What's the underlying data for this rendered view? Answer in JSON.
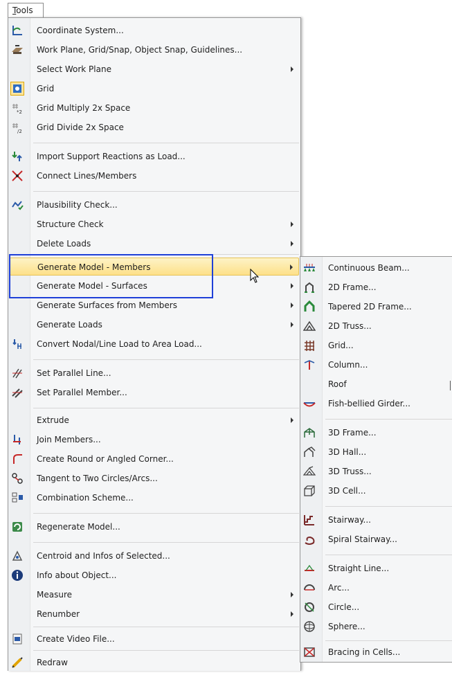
{
  "menubar": {
    "tools_mnemonic": "T",
    "tools_rest": "ools"
  },
  "colors": {
    "highlight": "#fde089",
    "focus_box": "#1f40d8"
  },
  "main_menu": {
    "items": [
      {
        "label": "Coordinate System...",
        "icon": "coordinate-system-icon",
        "has_submenu": false
      },
      {
        "label": "Work Plane, Grid/Snap, Object Snap, Guidelines...",
        "icon": "work-plane-icon",
        "has_submenu": false
      },
      {
        "label": "Select Work Plane",
        "icon": "",
        "has_submenu": true
      },
      {
        "label": "Grid",
        "icon": "grid-icon",
        "has_submenu": false,
        "checked": true
      },
      {
        "label": "Grid Multiply 2x Space",
        "icon": "grid-multiply-icon",
        "has_submenu": false
      },
      {
        "label": "Grid Divide 2x Space",
        "icon": "grid-divide-icon",
        "has_submenu": false
      },
      {
        "label": "Import Support Reactions as Load...",
        "icon": "import-reactions-icon",
        "has_submenu": false
      },
      {
        "label": "Connect Lines/Members",
        "icon": "connect-lines-icon",
        "has_submenu": false
      },
      {
        "label": "Plausibility Check...",
        "icon": "plausibility-check-icon",
        "has_submenu": false
      },
      {
        "label": "Structure Check",
        "icon": "",
        "has_submenu": true
      },
      {
        "label": "Delete Loads",
        "icon": "",
        "has_submenu": true
      },
      {
        "label": "Generate Model - Members",
        "icon": "",
        "has_submenu": true,
        "highlighted": true
      },
      {
        "label": "Generate Model - Surfaces",
        "icon": "",
        "has_submenu": true
      },
      {
        "label": "Generate Surfaces from Members",
        "icon": "",
        "has_submenu": true
      },
      {
        "label": "Generate Loads",
        "icon": "",
        "has_submenu": true
      },
      {
        "label": "Convert Nodal/Line Load to Area Load...",
        "icon": "convert-load-icon",
        "has_submenu": false
      },
      {
        "label": "Set Parallel Line...",
        "icon": "parallel-line-icon",
        "has_submenu": false
      },
      {
        "label": "Set Parallel Member...",
        "icon": "parallel-member-icon",
        "has_submenu": false
      },
      {
        "label": "Extrude",
        "icon": "",
        "has_submenu": true
      },
      {
        "label": "Join Members...",
        "icon": "join-members-icon",
        "has_submenu": false
      },
      {
        "label": "Create Round or Angled Corner...",
        "icon": "corner-icon",
        "has_submenu": false
      },
      {
        "label": "Tangent to Two Circles/Arcs...",
        "icon": "tangent-icon",
        "has_submenu": false
      },
      {
        "label": "Combination Scheme...",
        "icon": "combination-scheme-icon",
        "has_submenu": false
      },
      {
        "label": "Regenerate Model...",
        "icon": "regenerate-icon",
        "has_submenu": false
      },
      {
        "label": "Centroid and Infos of Selected...",
        "icon": "centroid-icon",
        "has_submenu": false
      },
      {
        "label": "Info about Object...",
        "icon": "info-icon",
        "has_submenu": false
      },
      {
        "label": "Measure",
        "icon": "",
        "has_submenu": true
      },
      {
        "label": "Renumber",
        "icon": "",
        "has_submenu": true
      },
      {
        "label": "Create Video File...",
        "icon": "video-file-icon",
        "has_submenu": false
      },
      {
        "label": "Redraw",
        "icon": "redraw-icon",
        "has_submenu": false
      }
    ]
  },
  "sub_menu": {
    "items": [
      {
        "label": "Continuous Beam...",
        "icon": "continuous-beam-icon"
      },
      {
        "label": "2D Frame...",
        "icon": "frame-2d-icon"
      },
      {
        "label": "Tapered 2D Frame...",
        "icon": "tapered-frame-icon"
      },
      {
        "label": "2D Truss...",
        "icon": "truss-2d-icon"
      },
      {
        "label": "Grid...",
        "icon": "grid-model-icon"
      },
      {
        "label": "Column...",
        "icon": "column-icon"
      },
      {
        "label": "Roof",
        "icon": ""
      },
      {
        "label": "Fish-bellied Girder...",
        "icon": "fish-girder-icon"
      },
      {
        "label": "3D Frame...",
        "icon": "frame-3d-icon"
      },
      {
        "label": "3D Hall...",
        "icon": "hall-3d-icon"
      },
      {
        "label": "3D Truss...",
        "icon": "truss-3d-icon"
      },
      {
        "label": "3D Cell...",
        "icon": "cell-3d-icon"
      },
      {
        "label": "Stairway...",
        "icon": "stairway-icon"
      },
      {
        "label": "Spiral Stairway...",
        "icon": "spiral-stairway-icon"
      },
      {
        "label": "Straight Line...",
        "icon": "straight-line-icon"
      },
      {
        "label": "Arc...",
        "icon": "arc-icon"
      },
      {
        "label": "Circle...",
        "icon": "circle-icon"
      },
      {
        "label": "Sphere...",
        "icon": "sphere-icon"
      },
      {
        "label": "Bracing in Cells...",
        "icon": "bracing-icon"
      }
    ]
  }
}
